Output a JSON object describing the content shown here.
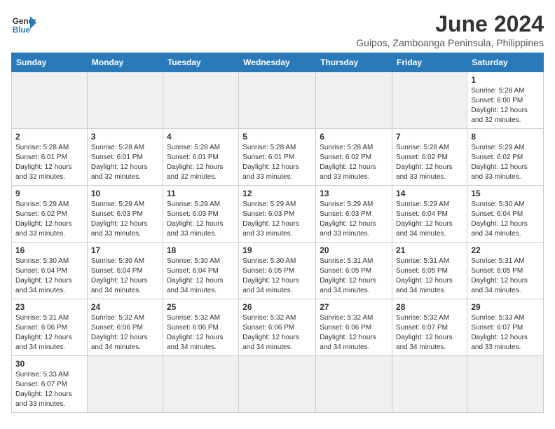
{
  "logo": {
    "text_general": "General",
    "text_blue": "Blue"
  },
  "header": {
    "month_year": "June 2024",
    "location": "Guipos, Zamboanga Peninsula, Philippines"
  },
  "weekdays": [
    "Sunday",
    "Monday",
    "Tuesday",
    "Wednesday",
    "Thursday",
    "Friday",
    "Saturday"
  ],
  "days": [
    {
      "date": "",
      "info": ""
    },
    {
      "date": "",
      "info": ""
    },
    {
      "date": "",
      "info": ""
    },
    {
      "date": "",
      "info": ""
    },
    {
      "date": "",
      "info": ""
    },
    {
      "date": "",
      "info": ""
    },
    {
      "date": "1",
      "info": "Sunrise: 5:28 AM\nSunset: 6:00 PM\nDaylight: 12 hours and 32 minutes."
    },
    {
      "date": "2",
      "info": "Sunrise: 5:28 AM\nSunset: 6:01 PM\nDaylight: 12 hours and 32 minutes."
    },
    {
      "date": "3",
      "info": "Sunrise: 5:28 AM\nSunset: 6:01 PM\nDaylight: 12 hours and 32 minutes."
    },
    {
      "date": "4",
      "info": "Sunrise: 5:28 AM\nSunset: 6:01 PM\nDaylight: 12 hours and 32 minutes."
    },
    {
      "date": "5",
      "info": "Sunrise: 5:28 AM\nSunset: 6:01 PM\nDaylight: 12 hours and 33 minutes."
    },
    {
      "date": "6",
      "info": "Sunrise: 5:28 AM\nSunset: 6:02 PM\nDaylight: 12 hours and 33 minutes."
    },
    {
      "date": "7",
      "info": "Sunrise: 5:28 AM\nSunset: 6:02 PM\nDaylight: 12 hours and 33 minutes."
    },
    {
      "date": "8",
      "info": "Sunrise: 5:29 AM\nSunset: 6:02 PM\nDaylight: 12 hours and 33 minutes."
    },
    {
      "date": "9",
      "info": "Sunrise: 5:29 AM\nSunset: 6:02 PM\nDaylight: 12 hours and 33 minutes."
    },
    {
      "date": "10",
      "info": "Sunrise: 5:29 AM\nSunset: 6:03 PM\nDaylight: 12 hours and 33 minutes."
    },
    {
      "date": "11",
      "info": "Sunrise: 5:29 AM\nSunset: 6:03 PM\nDaylight: 12 hours and 33 minutes."
    },
    {
      "date": "12",
      "info": "Sunrise: 5:29 AM\nSunset: 6:03 PM\nDaylight: 12 hours and 33 minutes."
    },
    {
      "date": "13",
      "info": "Sunrise: 5:29 AM\nSunset: 6:03 PM\nDaylight: 12 hours and 33 minutes."
    },
    {
      "date": "14",
      "info": "Sunrise: 5:29 AM\nSunset: 6:04 PM\nDaylight: 12 hours and 34 minutes."
    },
    {
      "date": "15",
      "info": "Sunrise: 5:30 AM\nSunset: 6:04 PM\nDaylight: 12 hours and 34 minutes."
    },
    {
      "date": "16",
      "info": "Sunrise: 5:30 AM\nSunset: 6:04 PM\nDaylight: 12 hours and 34 minutes."
    },
    {
      "date": "17",
      "info": "Sunrise: 5:30 AM\nSunset: 6:04 PM\nDaylight: 12 hours and 34 minutes."
    },
    {
      "date": "18",
      "info": "Sunrise: 5:30 AM\nSunset: 6:04 PM\nDaylight: 12 hours and 34 minutes."
    },
    {
      "date": "19",
      "info": "Sunrise: 5:30 AM\nSunset: 6:05 PM\nDaylight: 12 hours and 34 minutes."
    },
    {
      "date": "20",
      "info": "Sunrise: 5:31 AM\nSunset: 6:05 PM\nDaylight: 12 hours and 34 minutes."
    },
    {
      "date": "21",
      "info": "Sunrise: 5:31 AM\nSunset: 6:05 PM\nDaylight: 12 hours and 34 minutes."
    },
    {
      "date": "22",
      "info": "Sunrise: 5:31 AM\nSunset: 6:05 PM\nDaylight: 12 hours and 34 minutes."
    },
    {
      "date": "23",
      "info": "Sunrise: 5:31 AM\nSunset: 6:06 PM\nDaylight: 12 hours and 34 minutes."
    },
    {
      "date": "24",
      "info": "Sunrise: 5:32 AM\nSunset: 6:06 PM\nDaylight: 12 hours and 34 minutes."
    },
    {
      "date": "25",
      "info": "Sunrise: 5:32 AM\nSunset: 6:06 PM\nDaylight: 12 hours and 34 minutes."
    },
    {
      "date": "26",
      "info": "Sunrise: 5:32 AM\nSunset: 6:06 PM\nDaylight: 12 hours and 34 minutes."
    },
    {
      "date": "27",
      "info": "Sunrise: 5:32 AM\nSunset: 6:06 PM\nDaylight: 12 hours and 34 minutes."
    },
    {
      "date": "28",
      "info": "Sunrise: 5:32 AM\nSunset: 6:07 PM\nDaylight: 12 hours and 34 minutes."
    },
    {
      "date": "29",
      "info": "Sunrise: 5:33 AM\nSunset: 6:07 PM\nDaylight: 12 hours and 33 minutes."
    },
    {
      "date": "30",
      "info": "Sunrise: 5:33 AM\nSunset: 6:07 PM\nDaylight: 12 hours and 33 minutes."
    }
  ]
}
